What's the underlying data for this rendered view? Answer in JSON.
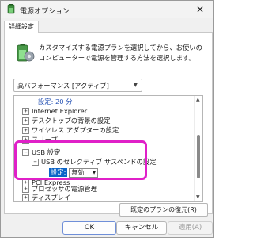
{
  "window": {
    "title": "電源オプション",
    "close_glyph": "✕"
  },
  "tab": {
    "label": "詳細設定"
  },
  "description": "カスタマイズする電源プランを選択してから、お使いのコンピューターで電源を管理する方法を選択します。",
  "plan_select": {
    "value": "高パフォーマンス [アクティブ]"
  },
  "tree": {
    "items": [
      {
        "kind": "setting",
        "label": "設定:",
        "value": "20 分"
      },
      {
        "kind": "node",
        "expander": "+",
        "label": "Internet Explorer"
      },
      {
        "kind": "node",
        "expander": "+",
        "label": "デスクトップの背景の設定"
      },
      {
        "kind": "node",
        "expander": "+",
        "label": "ワイヤレス アダプターの設定"
      },
      {
        "kind": "node",
        "expander": "+",
        "label": "スリープ"
      },
      {
        "kind": "node",
        "expander": "−",
        "label": "USB 設定"
      },
      {
        "kind": "node",
        "expander": "−",
        "label": "USB のセレクティブ サスペンドの設定"
      },
      {
        "kind": "selected-setting",
        "label": "設定:",
        "value": "無効"
      },
      {
        "kind": "node",
        "expander": "+",
        "label": "PCI Express"
      },
      {
        "kind": "node",
        "expander": "+",
        "label": "プロセッサの電源管理"
      },
      {
        "kind": "node",
        "expander": "+",
        "label": "ディスプレイ"
      }
    ]
  },
  "buttons": {
    "restore": "既定のプランの復元(R)",
    "ok": "OK",
    "cancel": "キャンセル",
    "apply": "適用(A)"
  },
  "icons": {
    "window": "power-options-icon",
    "plan": "power-plan-battery-icon",
    "close": "close-icon",
    "dropdown": "chevron-down-icon",
    "scroll_up": "scroll-up-arrow-icon",
    "scroll_down": "scroll-down-arrow-icon"
  },
  "colors": {
    "highlight_frame": "#e020c8",
    "selection": "#0a64c8",
    "setting_text": "#2a55b5"
  }
}
